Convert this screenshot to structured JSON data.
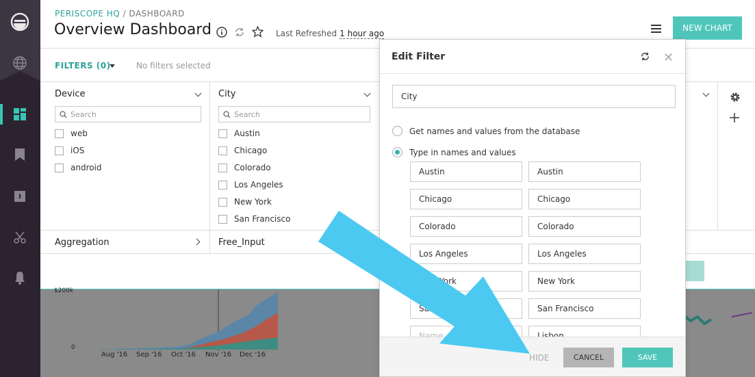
{
  "header": {
    "breadcrumb_org": "PERISCOPE HQ",
    "breadcrumb_sep": " / ",
    "breadcrumb_page": "DASHBOARD",
    "title": "Overview Dashboard",
    "last_refreshed_label": "Last Refreshed",
    "last_refreshed_value": "1 hour ago",
    "new_chart_label": "NEW CHART"
  },
  "filters_bar": {
    "label": "FILTERS (0)",
    "status": "No filters selected"
  },
  "filters": {
    "device": {
      "name": "Device",
      "search_placeholder": "Search",
      "options": [
        "web",
        "iOS",
        "android"
      ]
    },
    "city": {
      "name": "City",
      "search_placeholder": "Search",
      "options": [
        "Austin",
        "Chicago",
        "Colorado",
        "Los Angeles",
        "New York",
        "San Francisco"
      ]
    },
    "aggregation": "Aggregation",
    "free_input": "Free_Input"
  },
  "chart_preview": {
    "y_ticks": [
      "$200k",
      "0"
    ],
    "x_ticks": [
      "Aug '16",
      "Sep '16",
      "Oct '16",
      "Nov '16",
      "Dec '16"
    ]
  },
  "modal": {
    "title": "Edit Filter",
    "name_value": "City",
    "option_db": "Get names and values from the database",
    "option_manual": "Type in names and values",
    "pairs": [
      {
        "name": "Austin",
        "value": "Austin"
      },
      {
        "name": "Chicago",
        "value": "Chicago"
      },
      {
        "name": "Colorado",
        "value": "Colorado"
      },
      {
        "name": "Los Angeles",
        "value": "Los Angeles"
      },
      {
        "name": "New York",
        "value": "New York"
      },
      {
        "name": "San Francisco",
        "value": "San Francisco"
      },
      {
        "name": "Name",
        "value": "Lisbon"
      }
    ],
    "hide_label": "HIDE",
    "cancel_label": "CANCEL",
    "save_label": "SAVE"
  },
  "colors": {
    "accent": "#50c6bb",
    "nav_bg": "#2b2430",
    "arrow": "#4cc9f0"
  }
}
